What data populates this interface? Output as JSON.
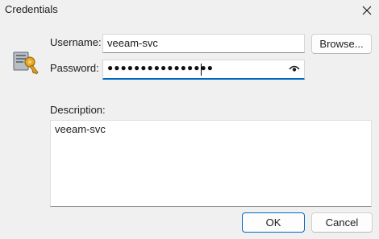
{
  "window": {
    "title": "Credentials",
    "close_icon": "close-icon"
  },
  "form": {
    "username_label": "Username:",
    "username_value": "veeam-svc",
    "browse_label": "Browse...",
    "password_label": "Password:",
    "password_mask": "●●●●●●●●●●●●●●●●",
    "reveal_icon": "eye-icon",
    "description_label": "Description:",
    "description_value": "veeam-svc"
  },
  "footer": {
    "ok_label": "OK",
    "cancel_label": "Cancel"
  },
  "colors": {
    "accent": "#0067c0",
    "background": "#f0f0f0"
  }
}
